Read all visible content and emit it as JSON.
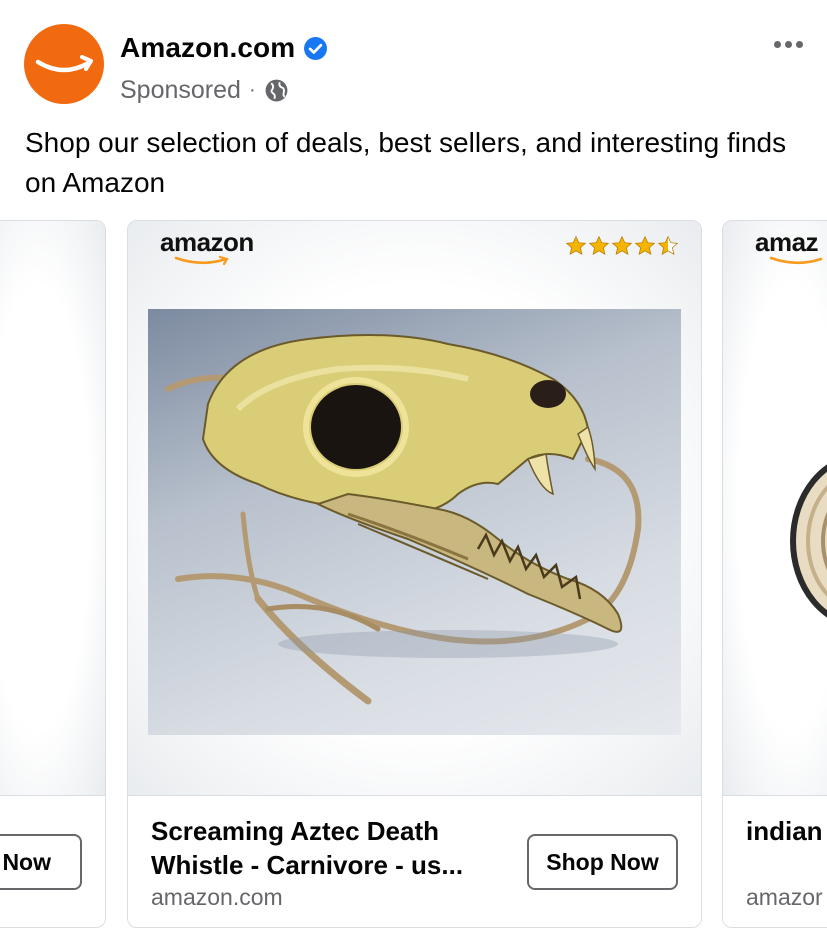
{
  "post": {
    "page_name": "Amazon.com",
    "sponsored_label": "Sponsored",
    "separator": "·",
    "caption": "Shop our selection of deals, best sellers, and interesting finds on Amazon"
  },
  "colors": {
    "avatar_bg": "#f26a10",
    "verified_blue": "#1877f2",
    "secondary_text": "#65676b",
    "card_border": "#dadde1",
    "star_gold": "#f5b400"
  },
  "icons": {
    "verified": "verified-badge-icon",
    "audience": "globe-icon",
    "more": "more-options-icon",
    "rating": "star-icon"
  },
  "carousel": {
    "cards": [
      {
        "logo": "",
        "title": "",
        "domain": "",
        "cta": "p Now"
      },
      {
        "logo": "amazon",
        "rating": 4.5,
        "title": "Screaming Aztec Death Whistle - Carnivore - us...",
        "domain": "amazon.com",
        "cta": "Shop Now"
      },
      {
        "logo": "amaz",
        "title": "indian desert",
        "domain": "amazor",
        "cta": ""
      }
    ]
  }
}
